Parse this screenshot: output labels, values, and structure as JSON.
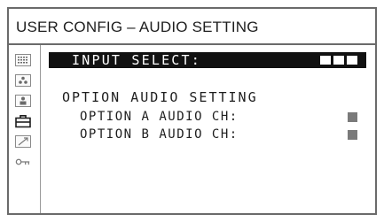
{
  "header": {
    "title": "USER CONFIG – AUDIO SETTING"
  },
  "icons": [
    {
      "name": "setup-grid-icon"
    },
    {
      "name": "dots-icon"
    },
    {
      "name": "person-icon"
    },
    {
      "name": "toolbox-icon"
    },
    {
      "name": "arrow-icon"
    },
    {
      "name": "key-icon"
    }
  ],
  "selected_icon": "toolbox-icon",
  "menu": {
    "input_select": {
      "label": "INPUT SELECT:",
      "value_blocks": 3
    },
    "section_title": "OPTION AUDIO SETTING",
    "option_a": {
      "label": "OPTION A AUDIO CH:"
    },
    "option_b": {
      "label": "OPTION B AUDIO CH:"
    }
  },
  "colors": {
    "highlight_bg": "#111111",
    "highlight_text": "#ffffff",
    "frame": "#6a6a6a",
    "value_block": "#7a7a7a"
  }
}
